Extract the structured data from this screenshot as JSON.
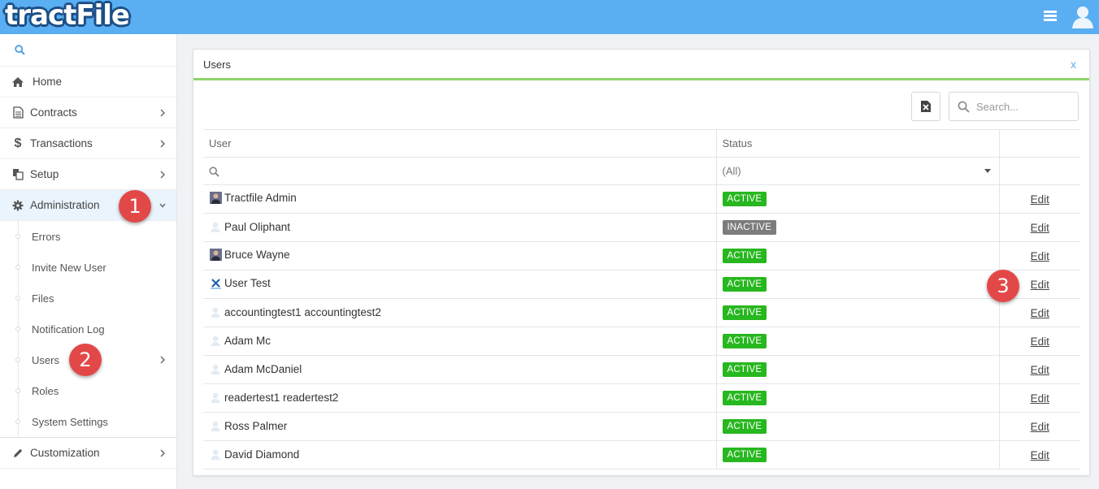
{
  "app": {
    "logo_text": "tractFile"
  },
  "sidebar": {
    "items": [
      {
        "label": "Home",
        "icon": "home-icon"
      },
      {
        "label": "Contracts",
        "icon": "document-icon"
      },
      {
        "label": "Transactions",
        "icon": "dollar-icon"
      },
      {
        "label": "Setup",
        "icon": "copy-icon"
      },
      {
        "label": "Administration",
        "icon": "gear-icon"
      }
    ],
    "admin_subitems": [
      "Errors",
      "Invite New User",
      "Files",
      "Notification Log",
      "Users",
      "Roles",
      "System Settings"
    ],
    "customization": {
      "label": "Customization",
      "icon": "pencil-icon"
    }
  },
  "callouts": [
    "1",
    "2",
    "3"
  ],
  "panel": {
    "title": "Users",
    "close_label": "x",
    "search_placeholder": "Search...",
    "columns": [
      "User",
      "Status",
      ""
    ],
    "status_filter": "(All)",
    "edit_label": "Edit",
    "rows": [
      {
        "name": "Tractfile Admin",
        "status": "ACTIVE",
        "avatar": "photo-avatar-icon"
      },
      {
        "name": "Paul Oliphant",
        "status": "INACTIVE",
        "avatar": "default-avatar-icon"
      },
      {
        "name": "Bruce Wayne",
        "status": "ACTIVE",
        "avatar": "photo-avatar-icon"
      },
      {
        "name": "User Test",
        "status": "ACTIVE",
        "avatar": "x-logo-avatar-icon"
      },
      {
        "name": "accountingtest1 accountingtest2",
        "status": "ACTIVE",
        "avatar": "default-avatar-icon"
      },
      {
        "name": "Adam Mc",
        "status": "ACTIVE",
        "avatar": "default-avatar-icon"
      },
      {
        "name": "Adam McDaniel",
        "status": "ACTIVE",
        "avatar": "default-avatar-icon"
      },
      {
        "name": "readertest1 readertest2",
        "status": "ACTIVE",
        "avatar": "default-avatar-icon"
      },
      {
        "name": "Ross Palmer",
        "status": "ACTIVE",
        "avatar": "default-avatar-icon"
      },
      {
        "name": "David Diamond",
        "status": "ACTIVE",
        "avatar": "default-avatar-icon"
      }
    ]
  },
  "colors": {
    "topbar": "#5aaef2",
    "accent_line": "#8fd36a",
    "active_status": "#27b71f",
    "inactive_status": "#7c7c7c",
    "callout": "#e34848"
  }
}
